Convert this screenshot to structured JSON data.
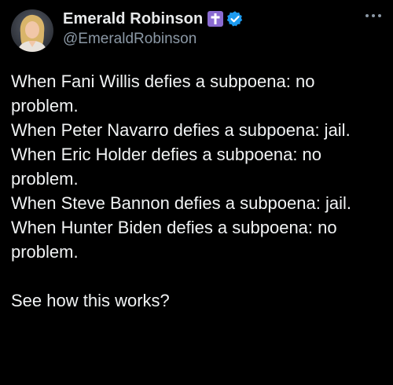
{
  "tweet": {
    "author": {
      "display_name": "Emerald Robinson",
      "handle": "@EmeraldRobinson",
      "badges": [
        "cross-icon",
        "verified-icon"
      ]
    },
    "text": "When Fani Willis defies a subpoena: no problem.\nWhen Peter Navarro defies a subpoena: jail.\nWhen Eric Holder defies a subpoena: no problem.\nWhen Steve Bannon defies a subpoena: jail.\nWhen Hunter Biden defies a subpoena: no problem.\n\nSee how this works?",
    "more_icon": "more-horizontal-icon"
  },
  "colors": {
    "background": "#000000",
    "text": "#e7e9ea",
    "handle": "#8b98a5",
    "cross_badge": "#8a6bd1",
    "verified_badge": "#1d9bf0"
  }
}
